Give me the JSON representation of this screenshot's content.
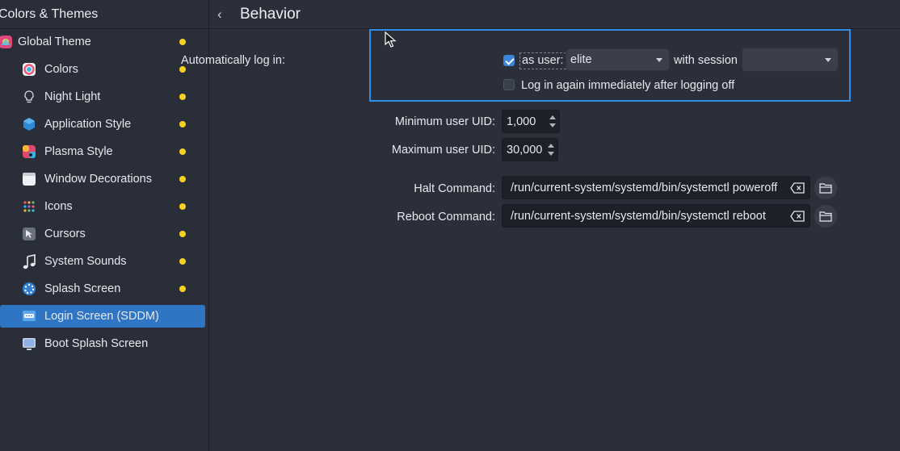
{
  "sidebar": {
    "title": "Colors & Themes",
    "items": [
      {
        "label": "Global Theme",
        "icon": "global-theme-icon",
        "dot": true
      },
      {
        "label": "Colors",
        "icon": "colors-icon",
        "dot": true
      },
      {
        "label": "Night Light",
        "icon": "night-light-icon",
        "dot": true
      },
      {
        "label": "Application Style",
        "icon": "application-style-icon",
        "dot": true
      },
      {
        "label": "Plasma Style",
        "icon": "plasma-style-icon",
        "dot": true
      },
      {
        "label": "Window Decorations",
        "icon": "window-decorations-icon",
        "dot": true
      },
      {
        "label": "Icons",
        "icon": "icons-icon",
        "dot": true
      },
      {
        "label": "Cursors",
        "icon": "cursors-icon",
        "dot": true
      },
      {
        "label": "System Sounds",
        "icon": "system-sounds-icon",
        "dot": true
      },
      {
        "label": "Splash Screen",
        "icon": "splash-screen-icon",
        "dot": true
      },
      {
        "label": "Login Screen (SDDM)",
        "icon": "login-screen-icon",
        "dot": false,
        "selected": true
      },
      {
        "label": "Boot Splash Screen",
        "icon": "boot-splash-icon",
        "dot": false
      }
    ]
  },
  "header": {
    "title": "Behavior"
  },
  "form": {
    "autologin_label": "Automatically log in:",
    "autologin_checked": true,
    "as_user_label": "as user:",
    "user_value": "elite",
    "with_session_label": "with session",
    "session_value": "",
    "relogin_label": "Log in again immediately after logging off",
    "relogin_checked": false,
    "min_uid_label": "Minimum user UID:",
    "min_uid_value": "1,000",
    "max_uid_label": "Maximum user UID:",
    "max_uid_value": "30,000",
    "halt_label": "Halt Command:",
    "halt_value": "/run/current-system/systemd/bin/systemctl poweroff",
    "reboot_label": "Reboot Command:",
    "reboot_value": "/run/current-system/systemd/bin/systemctl reboot"
  },
  "colors": {
    "accent": "#2e76c3",
    "focus": "#2f8fe6",
    "dot": "#f7d21e",
    "background": "#2b2f3a"
  }
}
